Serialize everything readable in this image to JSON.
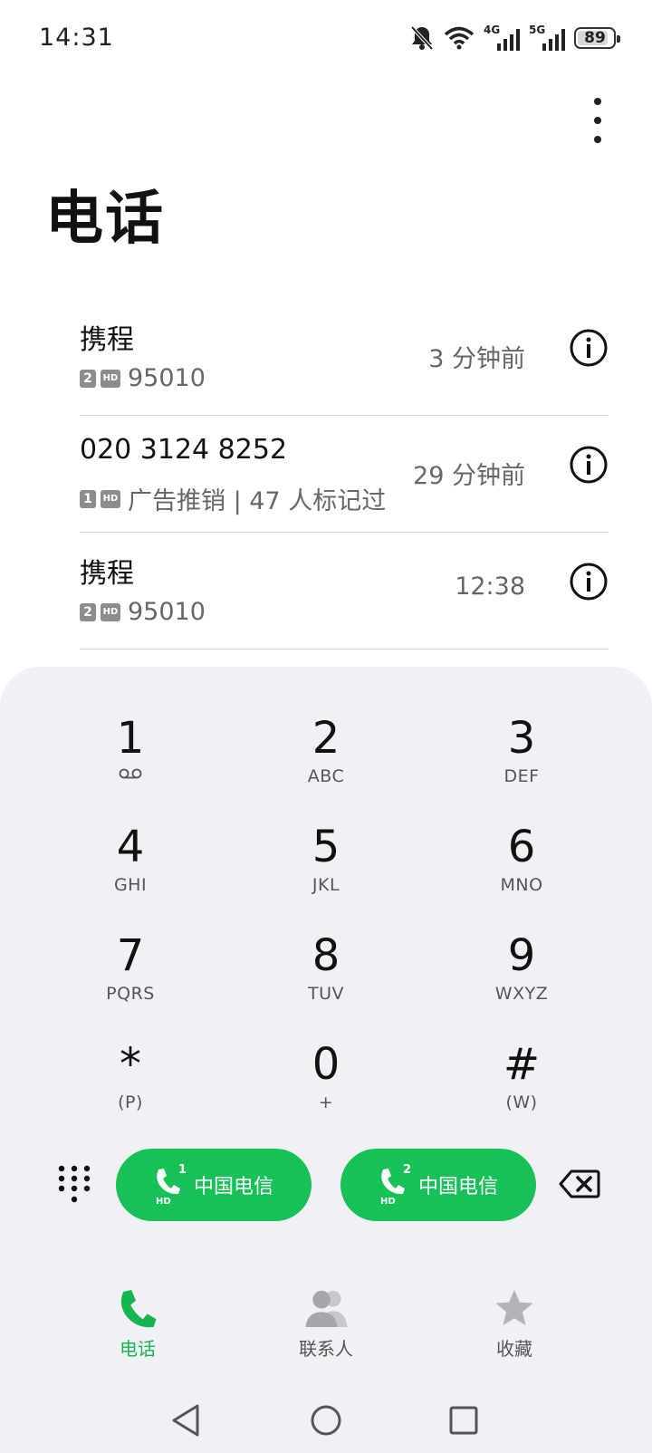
{
  "status_bar": {
    "time": "14:31",
    "sim1_label": "4G",
    "sim2_label": "5G",
    "battery": "89",
    "battery_level": 0.89
  },
  "header": {
    "title": "电话",
    "more_icon": "more-vertical-icon"
  },
  "call_log": [
    {
      "name": "携程",
      "sim": "2",
      "hd": "HD",
      "detail": "95010",
      "time": "3 分钟前"
    },
    {
      "name": "020 3124 8252",
      "sim": "1",
      "hd": "HD",
      "detail": "广告推销 | 47 人标记过",
      "time": "29 分钟前"
    },
    {
      "name": "携程",
      "sim": "2",
      "hd": "HD",
      "detail": "95010",
      "time": "12:38"
    }
  ],
  "dialpad": {
    "keys": [
      {
        "digit": "1",
        "letters": ""
      },
      {
        "digit": "2",
        "letters": "ABC"
      },
      {
        "digit": "3",
        "letters": "DEF"
      },
      {
        "digit": "4",
        "letters": "GHI"
      },
      {
        "digit": "5",
        "letters": "JKL"
      },
      {
        "digit": "6",
        "letters": "MNO"
      },
      {
        "digit": "7",
        "letters": "PQRS"
      },
      {
        "digit": "8",
        "letters": "TUV"
      },
      {
        "digit": "9",
        "letters": "WXYZ"
      },
      {
        "digit": "*",
        "letters": "(P)"
      },
      {
        "digit": "0",
        "letters": "+"
      },
      {
        "digit": "#",
        "letters": "(W)"
      }
    ]
  },
  "call_buttons": [
    {
      "sim": "1",
      "hd": "HD",
      "carrier": "中国电信"
    },
    {
      "sim": "2",
      "hd": "HD",
      "carrier": "中国电信"
    }
  ],
  "tabs": [
    {
      "label": "电话",
      "active": true
    },
    {
      "label": "联系人",
      "active": false
    },
    {
      "label": "收藏",
      "active": false
    }
  ],
  "colors": {
    "accent": "#17c157",
    "panel": "#f0f1f5"
  }
}
